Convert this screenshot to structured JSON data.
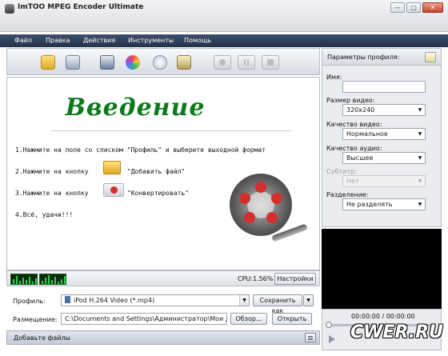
{
  "window": {
    "title": "ImTOO MPEG Encoder Ultimate",
    "min_glyph": "—",
    "max_glyph": "□",
    "close_glyph": "✕"
  },
  "menu": [
    "Файл",
    "Правка",
    "Действия",
    "Инструменты",
    "Помощь"
  ],
  "toolbar": {
    "icons": [
      "add-file-icon",
      "add-folder-icon",
      "clip-icon",
      "effects-icon",
      "add-profile-icon",
      "merge-icon",
      "convert-icon",
      "pause-icon",
      "stop-icon"
    ]
  },
  "preview": {
    "heading": "Введение",
    "steps": [
      "1.Нажмите на поле со списком \"Профиль\" и выберите выходной формат",
      "2.Нажмите на кнопку",
      "\"Добавить файл\"",
      "3.Нажмите на кнопку",
      "\"Конвертировать\"",
      "4.Всё, удачи!!!"
    ]
  },
  "status": {
    "cpu": "CPU:1.56%",
    "settings_button": "Настройки"
  },
  "profile": {
    "label": "Профиль:",
    "value": "iPod H.264 Video (*.mp4)",
    "save_as_button": "Сохранить как"
  },
  "destination": {
    "label": "Размещение:",
    "value": "C:\\Documents and Settings\\Администратор\\Мои док",
    "browse_button": "Обзор...",
    "open_button": "Открыть"
  },
  "bottom": {
    "add_files": "Добавьте файлы"
  },
  "right_panel": {
    "title": "Параметры профиля:",
    "name_label": "Имя:",
    "name_value": "",
    "video_size_label": "Размер видео:",
    "video_size_value": "320x240",
    "video_quality_label": "Качество видео:",
    "video_quality_value": "Нормальное",
    "audio_quality_label": "Качество аудио:",
    "audio_quality_value": "Высшее",
    "subtitle_label": "Субтитр:",
    "subtitle_value": "Нет",
    "split_label": "Разделение:",
    "split_value": "Не разделять"
  },
  "player": {
    "time": "00:00:00 / 00:00:00"
  },
  "watermark": "CWER.RU",
  "colors": {
    "menubar": "#22324a",
    "heading": "#0c7a1c",
    "record": "#d22f2f"
  }
}
